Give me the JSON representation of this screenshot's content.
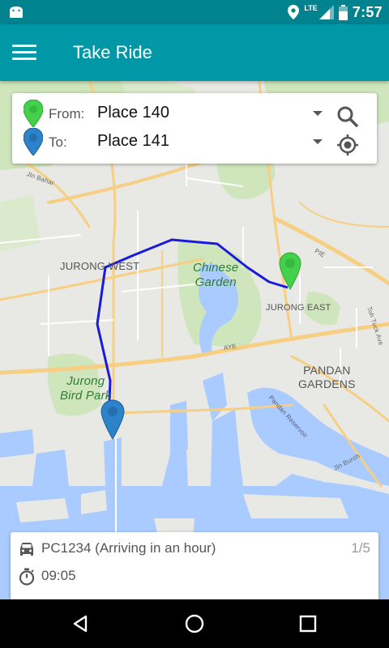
{
  "status_bar": {
    "time": "7:57",
    "network": "LTE",
    "icons": [
      "android-icon",
      "location-icon",
      "signal-icon",
      "battery-icon"
    ]
  },
  "app_bar": {
    "title": "Take Ride",
    "menu_icon": "hamburger-menu-icon"
  },
  "location_card": {
    "from_label": "From:",
    "from_value": "Place 140",
    "to_label": "To:",
    "to_value": "Place 141",
    "from_pin_color": "#43d14b",
    "to_pin_color": "#2d82c9",
    "search_icon": "search-icon",
    "locate_icon": "my-location-icon"
  },
  "map": {
    "labels": {
      "jurong_west": "JURONG WEST",
      "chinese_garden_1": "Chinese",
      "chinese_garden_2": "Garden",
      "jurong_east": "JURONG EAST",
      "pandan_gardens_1": "PANDAN",
      "pandan_gardens_2": "GARDENS",
      "jurong_bird_park_1": "Jurong",
      "jurong_bird_park_2": "Bird Park",
      "jln_bahar": "Jln Bahar",
      "pie": "PIE",
      "aye": "AYE",
      "pandan_reservoir": "Pandan Reservoir",
      "jln_buroh": "Jln Buroh",
      "toh_tuck_ave": "Toh Tuck Ave"
    },
    "route_color": "#1a1adb",
    "water_color": "#aacbff",
    "park_color": "#c8e6b0",
    "road_color": "#f9d48a"
  },
  "ride_card": {
    "vehicle": "PC1234 (Arriving in an hour)",
    "count": "1/5",
    "time": "09:05",
    "car_icon": "car-icon",
    "timer_icon": "timer-icon"
  },
  "nav_bar": {
    "buttons": [
      "back-icon",
      "home-icon",
      "recents-icon"
    ]
  }
}
